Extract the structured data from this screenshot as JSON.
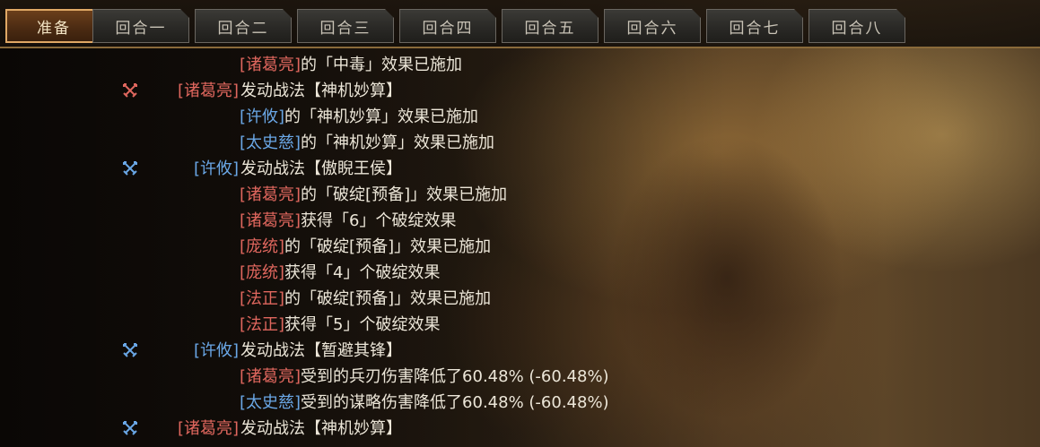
{
  "tabs": [
    {
      "label": "准备",
      "active": true
    },
    {
      "label": "回合一",
      "active": false
    },
    {
      "label": "回合二",
      "active": false
    },
    {
      "label": "回合三",
      "active": false
    },
    {
      "label": "回合四",
      "active": false
    },
    {
      "label": "回合五",
      "active": false
    },
    {
      "label": "回合六",
      "active": false
    },
    {
      "label": "回合七",
      "active": false
    },
    {
      "label": "回合八",
      "active": false
    }
  ],
  "colors": {
    "red_team": "#e0675e",
    "blue_team": "#6aa7e6",
    "text": "#ece6d8",
    "active_tab_border": "#e0a865"
  },
  "log": [
    {
      "kind": "effect",
      "actor": "诸葛亮",
      "side": "red",
      "text": "的「中毒」效果已施加"
    },
    {
      "kind": "skill",
      "icon": "crossed-swords-icon",
      "side": "red",
      "actor": "诸葛亮",
      "text": "发动战法【神机妙算】"
    },
    {
      "kind": "effect",
      "actor": "许攸",
      "side": "blue",
      "text": "的「神机妙算」效果已施加"
    },
    {
      "kind": "effect",
      "actor": "太史慈",
      "side": "blue",
      "text": "的「神机妙算」效果已施加"
    },
    {
      "kind": "skill",
      "icon": "crossed-swords-icon",
      "side": "blue",
      "actor": "许攸",
      "text": "发动战法【傲睨王侯】"
    },
    {
      "kind": "effect",
      "actor": "诸葛亮",
      "side": "red",
      "text": "的「破绽[预备]」效果已施加"
    },
    {
      "kind": "effect",
      "actor": "诸葛亮",
      "side": "red",
      "text": "获得「6」个破绽效果"
    },
    {
      "kind": "effect",
      "actor": "庞统",
      "side": "red",
      "text": "的「破绽[预备]」效果已施加"
    },
    {
      "kind": "effect",
      "actor": "庞统",
      "side": "red",
      "text": "获得「4」个破绽效果"
    },
    {
      "kind": "effect",
      "actor": "法正",
      "side": "red",
      "text": "的「破绽[预备]」效果已施加"
    },
    {
      "kind": "effect",
      "actor": "法正",
      "side": "red",
      "text": "获得「5」个破绽效果"
    },
    {
      "kind": "skill",
      "icon": "crossed-swords-icon",
      "side": "blue",
      "actor": "许攸",
      "text": "发动战法【暂避其锋】"
    },
    {
      "kind": "effect",
      "actor": "诸葛亮",
      "side": "red",
      "text": "受到的兵刃伤害降低了60.48% (-60.48%)"
    },
    {
      "kind": "effect",
      "actor": "太史慈",
      "side": "blue",
      "text": "受到的谋略伤害降低了60.48% (-60.48%)"
    },
    {
      "kind": "skill",
      "icon": "crossed-swords-icon",
      "side": "blue",
      "actor": "诸葛亮",
      "actor_side": "red",
      "text": "发动战法【神机妙算】"
    }
  ]
}
